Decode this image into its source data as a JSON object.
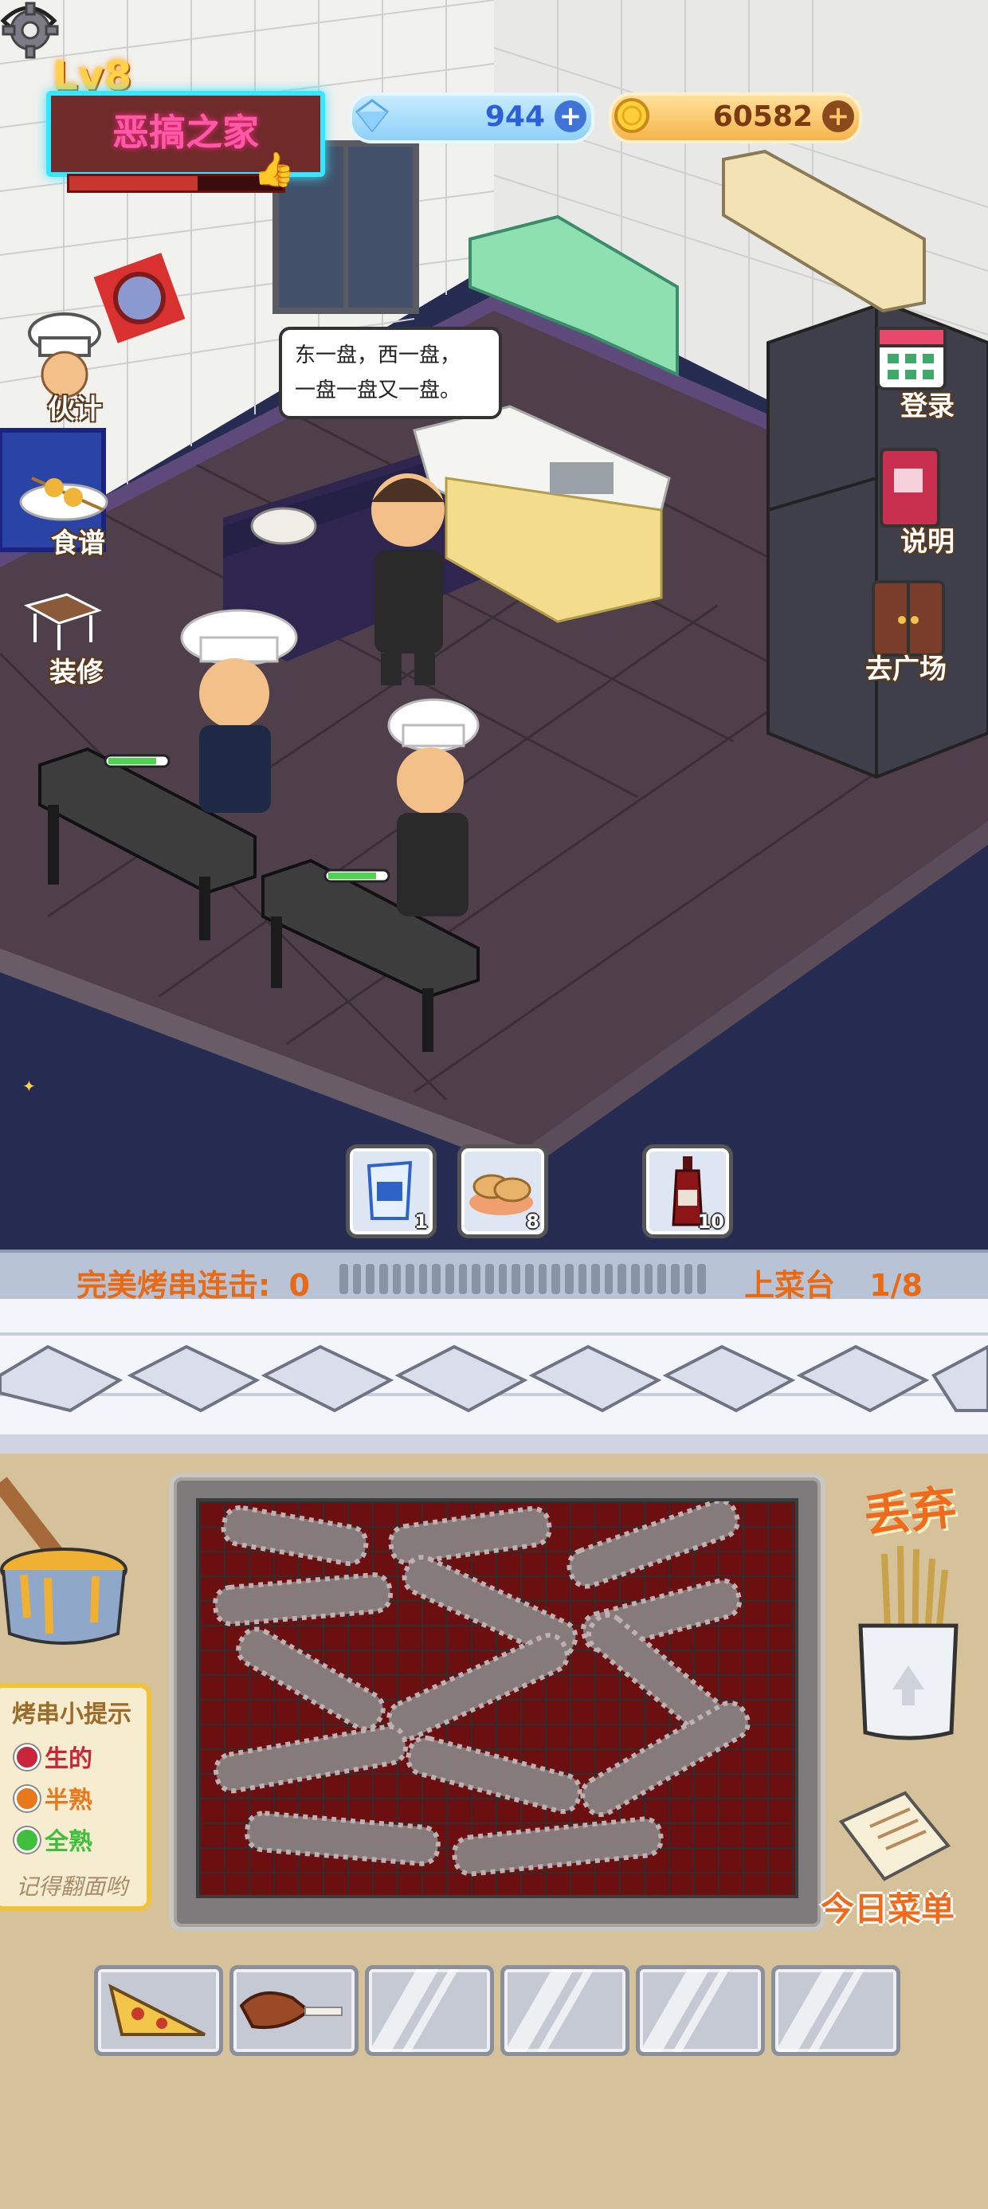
{
  "hud": {
    "level": "Lv8",
    "home_name": "恶搞之家",
    "home_bar_fraction": 0.6,
    "gems": "944",
    "coins": "60582"
  },
  "side_menu": {
    "left": [
      {
        "label": "伙计",
        "icon": "chef-icon"
      },
      {
        "label": "食谱",
        "icon": "recipe-skewer-icon"
      },
      {
        "label": "装修",
        "icon": "decor-table-icon"
      }
    ],
    "right": [
      {
        "label": "登录",
        "icon": "calendar-icon"
      },
      {
        "label": "说明",
        "icon": "book-icon"
      },
      {
        "label": "去广场",
        "icon": "door-icon"
      }
    ]
  },
  "speech_bubble": {
    "line1": "东一盘，西一盘，",
    "line2": "一盘一盘又一盘。"
  },
  "ingredients": [
    {
      "icon": "salt-bag-icon",
      "count": "1"
    },
    {
      "icon": "peanut-icon",
      "count": "8"
    },
    {
      "icon": "sauce-bottle-icon",
      "count": "10"
    }
  ],
  "combo": {
    "label": "完美烤串连击:",
    "value": "0",
    "serve_label": "上菜台",
    "serve_value": "1/8"
  },
  "tips": {
    "title": "烤串小提示",
    "items": [
      {
        "label": "生的",
        "color": "#c7263b"
      },
      {
        "label": "半熟",
        "color": "#e8781c"
      },
      {
        "label": "全熟",
        "color": "#3fbf3c"
      }
    ],
    "note": "记得翻面哟"
  },
  "discard": {
    "label": "丢弃"
  },
  "menu": {
    "label": "今日菜单"
  },
  "slots": [
    {
      "item": "pizza-slice-icon"
    },
    {
      "item": "lamb-leg-icon"
    },
    {
      "item": ""
    },
    {
      "item": ""
    },
    {
      "item": ""
    },
    {
      "item": ""
    }
  ],
  "colors": {
    "accent": "#ef6a1a",
    "neon": "#3ae6ff",
    "grill_red": "#6b0f10"
  }
}
